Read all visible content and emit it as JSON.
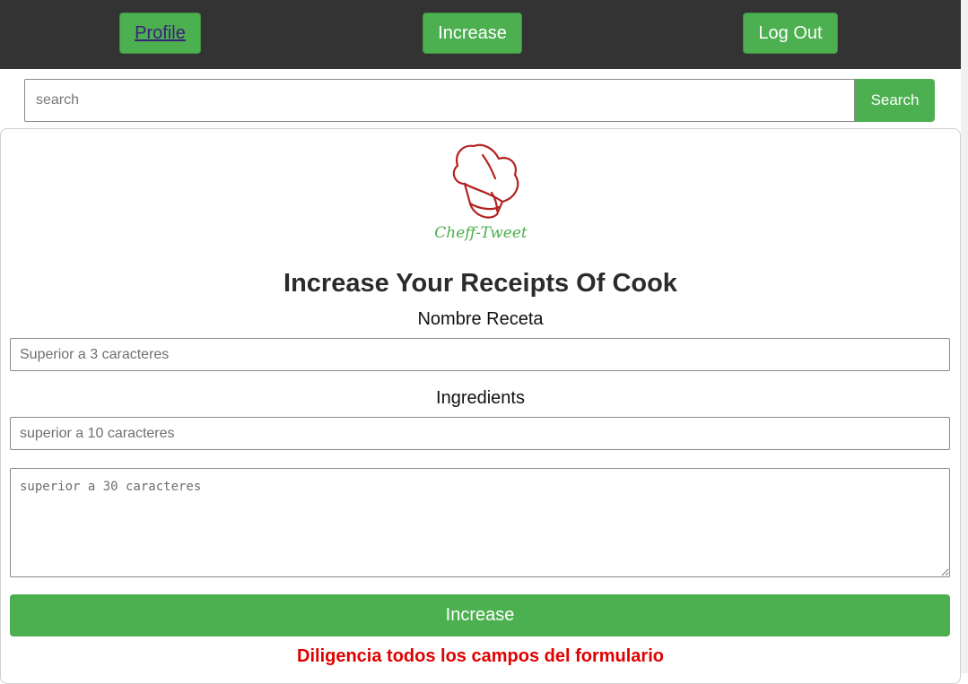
{
  "nav": {
    "profile_label": "Profile",
    "increase_label": "Increase",
    "logout_label": "Log Out"
  },
  "search": {
    "placeholder": "search",
    "button_label": "Search"
  },
  "logo": {
    "text": "Cheff-Tweet",
    "icon": "chef-hat-icon"
  },
  "form": {
    "title": "Increase Your Receipts Of Cook",
    "name_label": "Nombre Receta",
    "name_placeholder": "Superior a 3 caracteres",
    "ingredients_label": "Ingredients",
    "ingredients_placeholder": "superior a 10 caracteres",
    "description_placeholder": "superior a 30 caracteres",
    "submit_label": "Increase",
    "error_message": "Diligencia todos los campos del formulario"
  },
  "colors": {
    "accent_green": "#4caf50",
    "topbar": "#333333",
    "error_red": "#e00000",
    "logo_red": "#b22222"
  }
}
